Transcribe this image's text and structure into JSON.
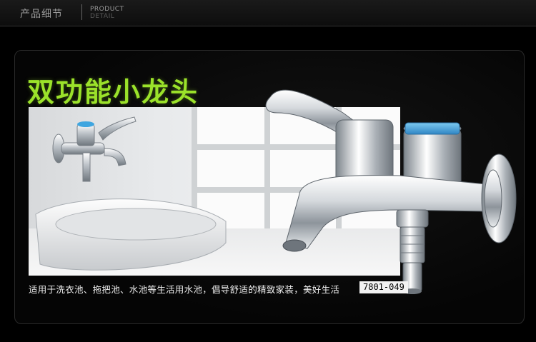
{
  "header": {
    "title_cn": "产品细节",
    "title_en_1": "PRODUCT",
    "title_en_2": "DETAIL"
  },
  "headline": "双功能小龙头",
  "caption": "适用于洗衣池、拖把池、水池等生活用水池，倡导舒适的精致家装，美好生活",
  "model": "7801-049",
  "colors": {
    "headline_green": "#9be22a",
    "cap_blue": "#3fa6e0",
    "chrome": "#c9ced3"
  }
}
